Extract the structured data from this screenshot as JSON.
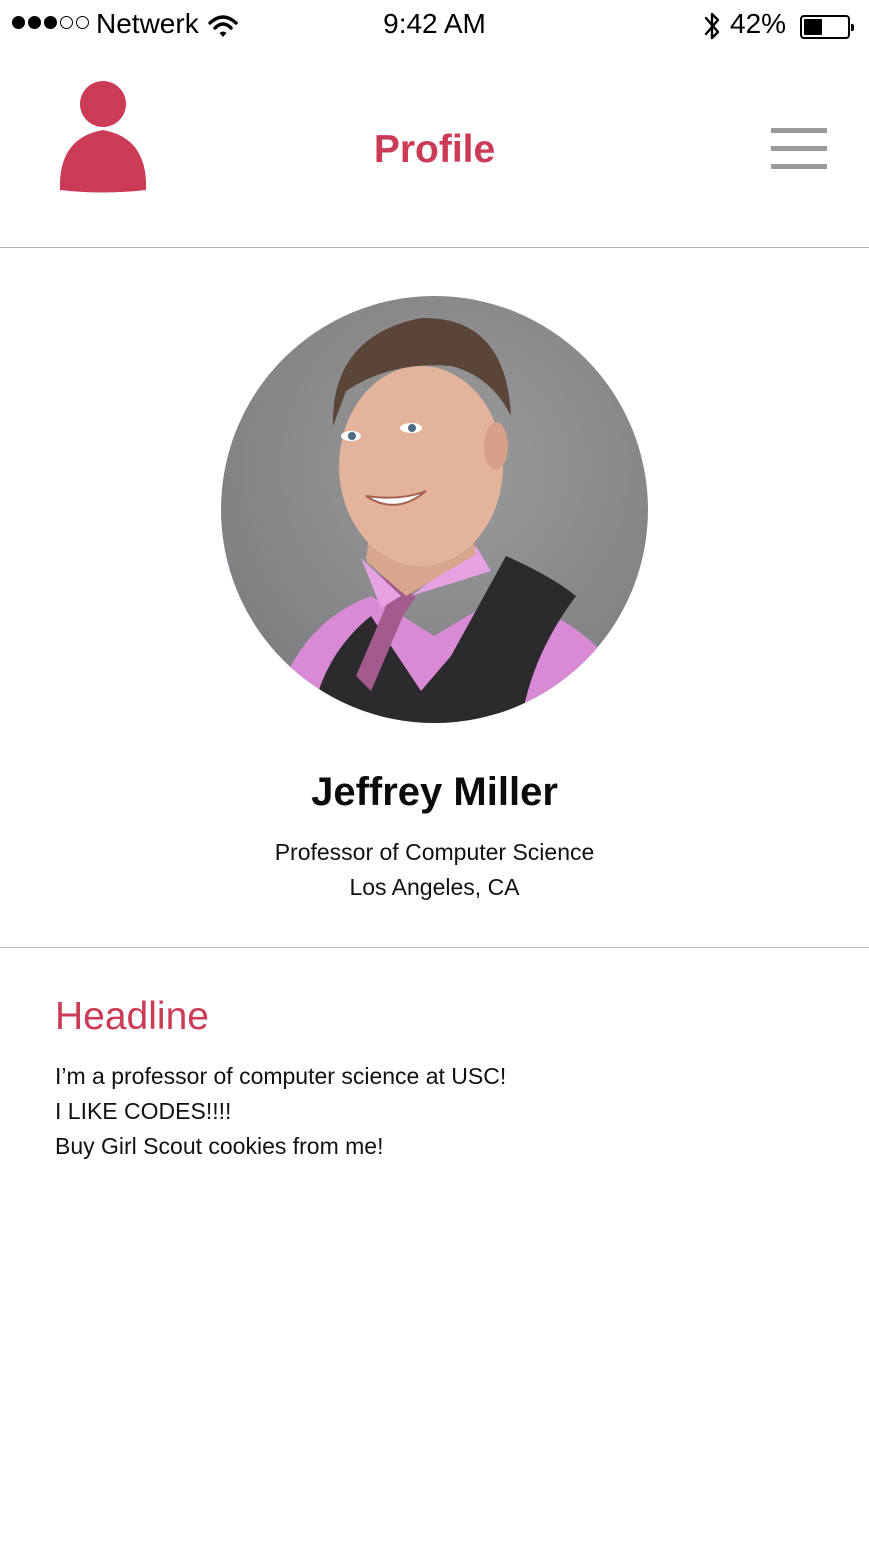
{
  "status_bar": {
    "signal_dots_filled": 3,
    "signal_dots_total": 5,
    "carrier": "Netwerk",
    "time": "9:42 AM",
    "battery": "42%",
    "battery_level": 0.42
  },
  "nav": {
    "title": "Profile",
    "left_icon": "person-icon",
    "right_icon": "hamburger-menu-icon"
  },
  "profile": {
    "photo": "profile-photo",
    "name": "Jeffrey Miller",
    "title": "Professor of Computer Science",
    "location": "Los Angeles, CA"
  },
  "headline": {
    "title": "Headline",
    "lines": [
      "I’m a professor of computer science at USC!",
      "I LIKE CODES!!!!",
      "Buy Girl Scout cookies from me!"
    ]
  },
  "colors": {
    "accent": "#cc3b56",
    "menu_icon": "#9b9b9b",
    "divider": "#b4b4b4"
  }
}
